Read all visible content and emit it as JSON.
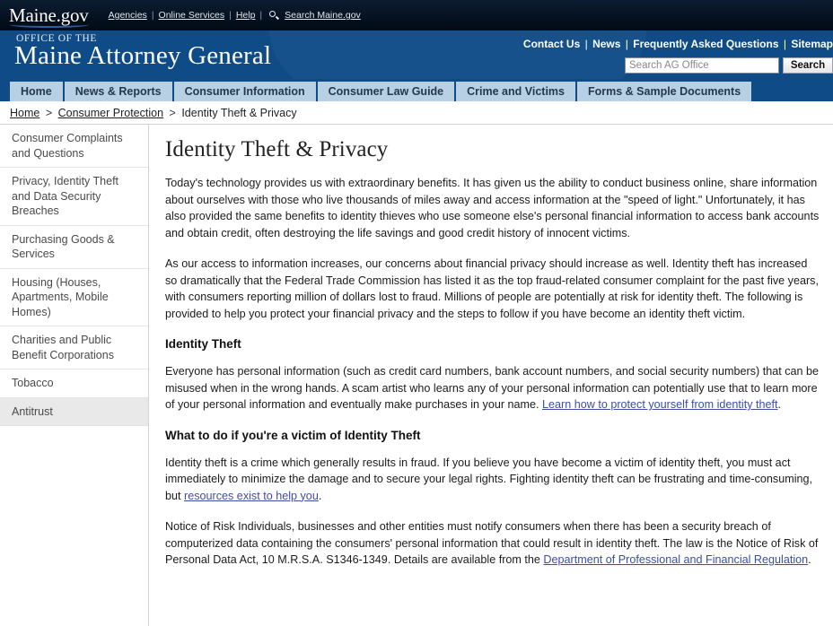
{
  "topbar": {
    "logo_text": "Maine.gov",
    "links": [
      {
        "label": "Agencies"
      },
      {
        "label": "Online Services"
      },
      {
        "label": "Help"
      },
      {
        "label": "Search Maine.gov"
      }
    ],
    "search_icon": "search-icon",
    "separator": "|"
  },
  "banner": {
    "eyebrow": "OFFICE OF THE",
    "title": "Maine Attorney General",
    "links": [
      {
        "label": "Contact Us"
      },
      {
        "label": "News"
      },
      {
        "label": "Frequently Asked Questions"
      },
      {
        "label": "Sitemap"
      }
    ],
    "separator": "|",
    "search": {
      "value": "",
      "placeholder": "Search AG Office",
      "button_label": "Search"
    },
    "bg_color": "#0e4b87"
  },
  "nav": {
    "tabs": [
      {
        "label": "Home"
      },
      {
        "label": "News & Reports"
      },
      {
        "label": "Consumer Information"
      },
      {
        "label": "Consumer Law Guide"
      },
      {
        "label": "Crime and Victims"
      },
      {
        "label": "Forms & Sample Documents"
      }
    ],
    "tab_bg": "#b8d0e3"
  },
  "breadcrumb": {
    "items": [
      {
        "label": "Home",
        "link": true
      },
      {
        "label": "Consumer Protection",
        "link": true
      },
      {
        "label": "Identity Theft & Privacy",
        "link": false
      }
    ],
    "separator": ">"
  },
  "sidebar": {
    "items": [
      {
        "label": "Consumer Complaints and Questions",
        "active": false
      },
      {
        "label": "Privacy, Identity Theft and Data Security Breaches",
        "active": false
      },
      {
        "label": "Purchasing Goods & Services",
        "active": false
      },
      {
        "label": "Housing (Houses, Apartments, Mobile Homes)",
        "active": false
      },
      {
        "label": "Charities and Public Benefit Corporations",
        "active": false
      },
      {
        "label": "Tobacco",
        "active": false
      },
      {
        "label": "Antitrust",
        "active": true
      }
    ],
    "active_bg": "#e9e9e9"
  },
  "main": {
    "title": "Identity Theft & Privacy",
    "paragraph_1": "Today's technology provides us with extraordinary benefits. It has given us the ability to conduct business online, share information about ourselves with those who live thousands of miles away and access information at the \"speed of light.\" Unfortunately, it has also provided the same benefits to identity thieves who use someone else's personal financial information to access bank accounts and obtain credit, often destroying the life savings and good credit history of innocent victims.",
    "paragraph_2": "As our access to information increases, our concerns about financial privacy should increase as well. Identity theft has increased so dramatically that the Federal Trade Commission has listed it as the top fraud-related consumer complaint for the past five years, with consumers reporting million of dollars lost to fraud. Millions of people are potentially at risk for identity theft. The following is provided to help you protect your financial privacy and the steps to follow if you have become an identity theft victim.",
    "heading_identity_theft": "Identity Theft",
    "paragraph_3_before_link": "Everyone has personal information (such as credit card numbers, bank account numbers, and social security numbers) that can be misused when in the wrong hands. A scam artist who learns any of your personal information can potentially use that to learn more of your personal information and eventually make purchases in your name. ",
    "paragraph_3_link": "Learn how to protect yourself from identity theft",
    "paragraph_3_after_link": ".",
    "heading_victim": "What to do if you're a victim of Identity Theft",
    "paragraph_4_before_link": "Identity theft is a crime which generally results in fraud. If you believe you have become a victim of identity theft, you must act immediately to minimize the damage and to secure your legal rights. Fighting identity theft can be frustrating and time-consuming, but ",
    "paragraph_4_link": "resources exist to help you",
    "paragraph_4_after_link": ".",
    "paragraph_5_before_link": "Notice of Risk Individuals, businesses and other entities must notify consumers when there has been a security breach of computerized data containing the consumers' personal information that could result in identity theft. The law is the Notice of Risk of Personal Data Act, 10 M.R.S.A. S1346-1349. Details are available from the ",
    "paragraph_5_link": "Department of Professional and Financial Regulation",
    "paragraph_5_after_link": ".",
    "link_color": "#3b4ea8"
  }
}
